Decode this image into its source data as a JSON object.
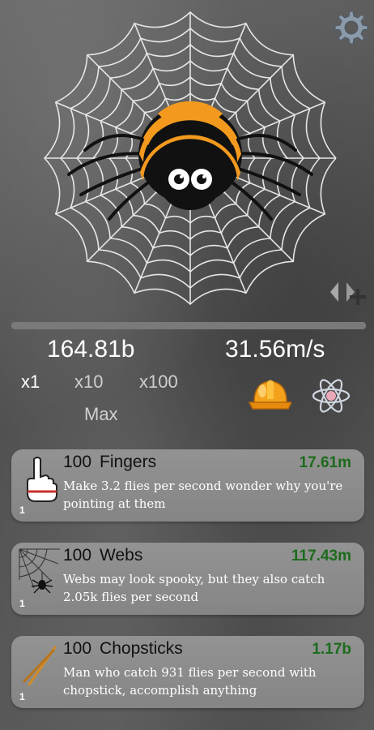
{
  "stats": {
    "flies": "164.81b",
    "rate": "31.56m/s"
  },
  "progress": {
    "fraction": 0.0
  },
  "multipliers": {
    "x1": "x1",
    "x10": "x10",
    "x100": "x100",
    "max": "Max"
  },
  "upgrades": [
    {
      "count": "100",
      "name": "Fingers",
      "cost": "17.61m",
      "level": "1",
      "desc": "Make 3.2 flies per second wonder why you're pointing at them",
      "icon": "pointing-finger-icon"
    },
    {
      "count": "100",
      "name": "Webs",
      "cost": "117.43m",
      "level": "1",
      "desc": "Webs may look spooky, but they also catch 2.05k flies per second",
      "icon": "spider-web-icon"
    },
    {
      "count": "100",
      "name": "Chopsticks",
      "cost": "1.17b",
      "level": "1",
      "desc": "Man who catch 931 flies per second with chopstick, accomplish anything",
      "icon": "chopsticks-icon"
    }
  ],
  "icons": {
    "settings": "gear-icon",
    "swap": "swap-add-icon",
    "helmet": "hard-hat-icon",
    "science": "atom-icon",
    "spider": "spider-icon"
  },
  "colors": {
    "spider_orange": "#f39a1e",
    "cost_green": "#1d6b1d",
    "card_bg": "#8c8c8c"
  }
}
